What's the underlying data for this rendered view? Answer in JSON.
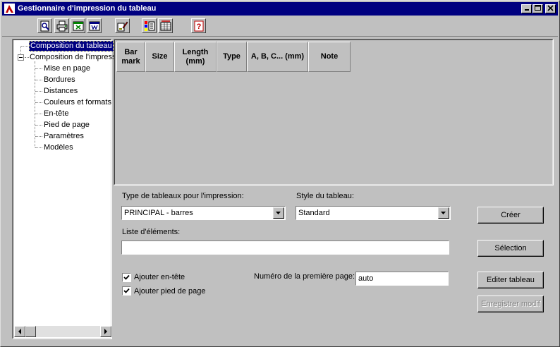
{
  "window": {
    "title": "Gestionnaire d'impression du tableau"
  },
  "toolbar": {
    "buttons": [
      {
        "icon": "preview-icon"
      },
      {
        "icon": "print-icon"
      },
      {
        "icon": "excel-export-icon"
      },
      {
        "icon": "word-export-icon"
      },
      {
        "icon": "pen-edit-icon"
      },
      {
        "icon": "color-palette-icon"
      },
      {
        "icon": "table-columns-icon"
      },
      {
        "icon": "help-icon"
      }
    ]
  },
  "tree": {
    "items": [
      {
        "label": "Composition du tableau",
        "selected": true
      },
      {
        "label": "Composition de l'impress"
      },
      {
        "label": "Mise en page"
      },
      {
        "label": "Bordures"
      },
      {
        "label": "Distances"
      },
      {
        "label": "Couleurs et formats"
      },
      {
        "label": "En-tête"
      },
      {
        "label": "Pied de page"
      },
      {
        "label": "Paramètres"
      },
      {
        "label": "Modèles"
      }
    ]
  },
  "grid": {
    "columns": [
      "Bar\nmark",
      "Size",
      "Length\n(mm)",
      "Type",
      "A, B, C... (mm)",
      "Note"
    ]
  },
  "form": {
    "table_type_label": "Type de tableaux pour l'impression:",
    "table_type_value": "PRINCIPAL - barres",
    "style_label": "Style du tableau:",
    "style_value": "Standard",
    "elements_label": "Liste d'éléments:",
    "elements_value": "",
    "add_header_label": "Ajouter en-tête",
    "add_header_checked": true,
    "add_footer_label": "Ajouter pied de page",
    "add_footer_checked": true,
    "first_page_label": "Numéro de la première page:",
    "first_page_value": "auto"
  },
  "buttons": {
    "create": "Créer",
    "selection": "Sélection",
    "edit_table": "Editer tableau",
    "save_changes": "Enregistrer modif"
  }
}
